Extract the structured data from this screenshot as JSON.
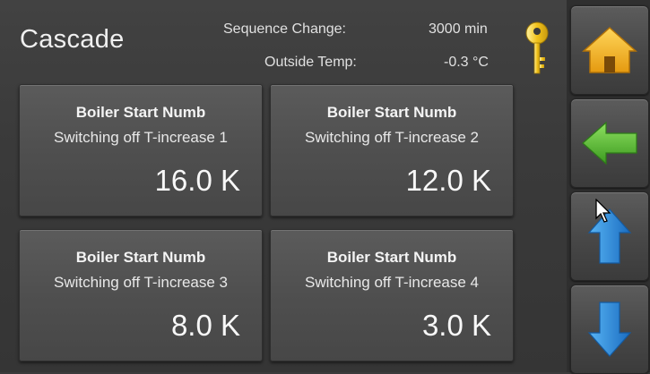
{
  "header": {
    "title": "Cascade",
    "sequence_change_label": "Sequence Change:",
    "sequence_change_value": "3000 min",
    "outside_temp_label": "Outside Temp:",
    "outside_temp_value": "-0.3 °C"
  },
  "tiles": [
    {
      "heading": "Boiler Start Numb",
      "subtitle": "Switching off T-increase 1",
      "value": "16.0 K"
    },
    {
      "heading": "Boiler Start Numb",
      "subtitle": "Switching off T-increase 2",
      "value": "12.0 K"
    },
    {
      "heading": "Boiler Start Numb",
      "subtitle": "Switching off T-increase 3",
      "value": "8.0 K"
    },
    {
      "heading": "Boiler Start Numb",
      "subtitle": "Switching off T-increase 4",
      "value": "3.0 K"
    }
  ],
  "sidebar": {
    "buttons": [
      {
        "icon": "home-icon",
        "color": "#f0b020"
      },
      {
        "icon": "arrow-left-icon",
        "color": "#52b030"
      },
      {
        "icon": "arrow-up-icon",
        "color": "#2a88d8"
      },
      {
        "icon": "arrow-down-icon",
        "color": "#2a88d8"
      }
    ]
  },
  "colors": {
    "key": "#f2c21a",
    "home": "#f0b020",
    "back": "#52b030",
    "scroll": "#2a88d8"
  }
}
